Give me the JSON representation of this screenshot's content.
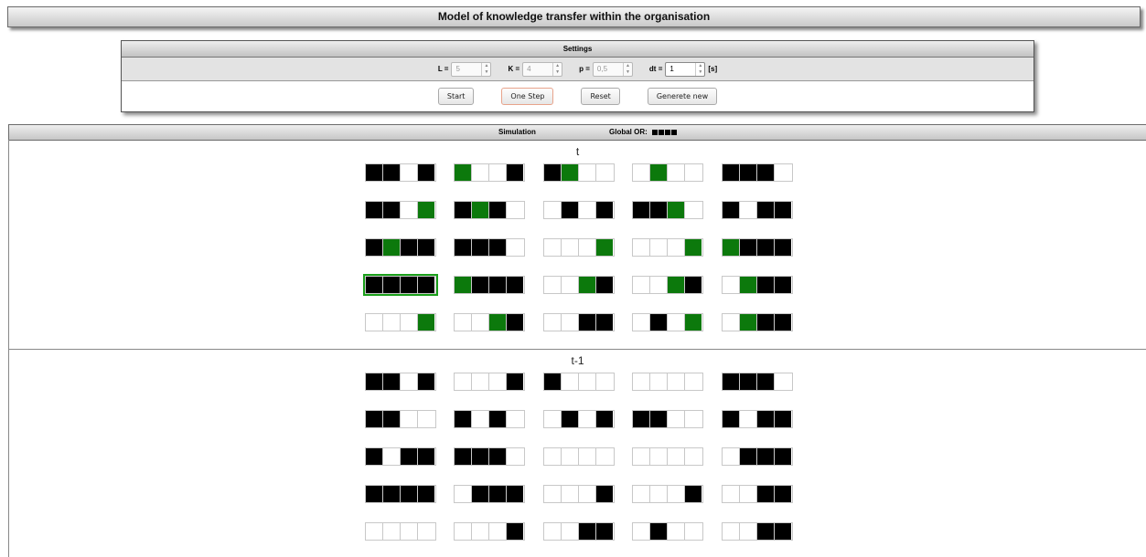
{
  "title": "Model of knowledge transfer within the organisation",
  "settings": {
    "title": "Settings",
    "params": [
      {
        "label": "L =",
        "value": "5",
        "active": false,
        "unit": ""
      },
      {
        "label": "K =",
        "value": "4",
        "active": false,
        "unit": ""
      },
      {
        "label": "p =",
        "value": "0,5",
        "active": false,
        "unit": ""
      },
      {
        "label": "dt =",
        "value": "1",
        "active": true,
        "unit": "[s]"
      }
    ],
    "buttons": [
      "Start",
      "One Step",
      "Reset",
      "Generete new"
    ]
  },
  "simulation": {
    "label": "Simulation",
    "global_label": "Global OR:",
    "global_or": [
      1,
      1,
      1,
      1
    ]
  },
  "colors": {
    "black": "#000000",
    "green": "#0c790c",
    "selected_outline": "#1a9f1a"
  },
  "panel_t": {
    "label": "t",
    "selected": [
      3,
      0
    ],
    "rows": [
      [
        [
          "b",
          "b",
          "w",
          "b"
        ],
        [
          "g",
          "w",
          "w",
          "b"
        ],
        [
          "b",
          "g",
          "w",
          "w"
        ],
        [
          "w",
          "g",
          "w",
          "w"
        ],
        [
          "b",
          "b",
          "b",
          "w"
        ]
      ],
      [
        [
          "b",
          "b",
          "w",
          "g"
        ],
        [
          "b",
          "g",
          "b",
          "w"
        ],
        [
          "w",
          "b",
          "w",
          "b"
        ],
        [
          "b",
          "b",
          "g",
          "w"
        ],
        [
          "b",
          "w",
          "b",
          "b"
        ]
      ],
      [
        [
          "b",
          "g",
          "b",
          "b"
        ],
        [
          "b",
          "b",
          "b",
          "w"
        ],
        [
          "w",
          "w",
          "w",
          "g"
        ],
        [
          "w",
          "w",
          "w",
          "g"
        ],
        [
          "g",
          "b",
          "b",
          "b"
        ]
      ],
      [
        [
          "b",
          "b",
          "b",
          "b"
        ],
        [
          "g",
          "b",
          "b",
          "b"
        ],
        [
          "w",
          "w",
          "g",
          "b"
        ],
        [
          "w",
          "w",
          "g",
          "b"
        ],
        [
          "w",
          "g",
          "b",
          "b"
        ]
      ],
      [
        [
          "w",
          "w",
          "w",
          "g"
        ],
        [
          "w",
          "w",
          "g",
          "b"
        ],
        [
          "w",
          "w",
          "b",
          "b"
        ],
        [
          "w",
          "b",
          "w",
          "g"
        ],
        [
          "w",
          "g",
          "b",
          "b"
        ]
      ]
    ]
  },
  "panel_t1": {
    "label": "t-1",
    "rows": [
      [
        [
          "b",
          "b",
          "w",
          "b"
        ],
        [
          "w",
          "w",
          "w",
          "b"
        ],
        [
          "b",
          "w",
          "w",
          "w"
        ],
        [
          "w",
          "w",
          "w",
          "w"
        ],
        [
          "b",
          "b",
          "b",
          "w"
        ]
      ],
      [
        [
          "b",
          "b",
          "w",
          "w"
        ],
        [
          "b",
          "w",
          "b",
          "w"
        ],
        [
          "w",
          "b",
          "w",
          "b"
        ],
        [
          "b",
          "b",
          "w",
          "w"
        ],
        [
          "b",
          "w",
          "b",
          "b"
        ]
      ],
      [
        [
          "b",
          "w",
          "b",
          "b"
        ],
        [
          "b",
          "b",
          "b",
          "w"
        ],
        [
          "w",
          "w",
          "w",
          "w"
        ],
        [
          "w",
          "w",
          "w",
          "w"
        ],
        [
          "w",
          "b",
          "b",
          "b"
        ]
      ],
      [
        [
          "b",
          "b",
          "b",
          "b"
        ],
        [
          "w",
          "b",
          "b",
          "b"
        ],
        [
          "w",
          "w",
          "w",
          "b"
        ],
        [
          "w",
          "w",
          "w",
          "b"
        ],
        [
          "w",
          "w",
          "b",
          "b"
        ]
      ],
      [
        [
          "w",
          "w",
          "w",
          "w"
        ],
        [
          "w",
          "w",
          "w",
          "b"
        ],
        [
          "w",
          "w",
          "b",
          "b"
        ],
        [
          "w",
          "b",
          "w",
          "w"
        ],
        [
          "w",
          "w",
          "b",
          "b"
        ]
      ]
    ]
  }
}
